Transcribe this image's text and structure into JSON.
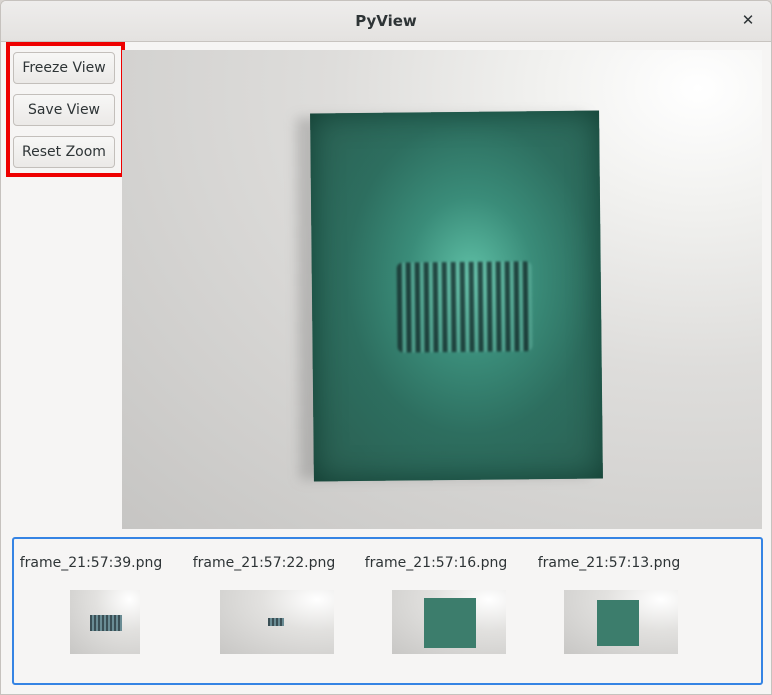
{
  "window": {
    "title": "PyView",
    "close_glyph": "✕"
  },
  "toolbar": {
    "freeze_label": "Freeze View",
    "save_label": "Save View",
    "reset_zoom_label": "Reset Zoom"
  },
  "thumbnails": [
    {
      "filename": "frame_21:57:39.png"
    },
    {
      "filename": "frame_21:57:22.png"
    },
    {
      "filename": "frame_21:57:16.png"
    },
    {
      "filename": "frame_21:57:13.png"
    }
  ],
  "colors": {
    "accent": "#3584e4",
    "highlight": "#ee0000",
    "poster": "#2d6e5f"
  },
  "icons": {
    "close": "close-icon"
  }
}
